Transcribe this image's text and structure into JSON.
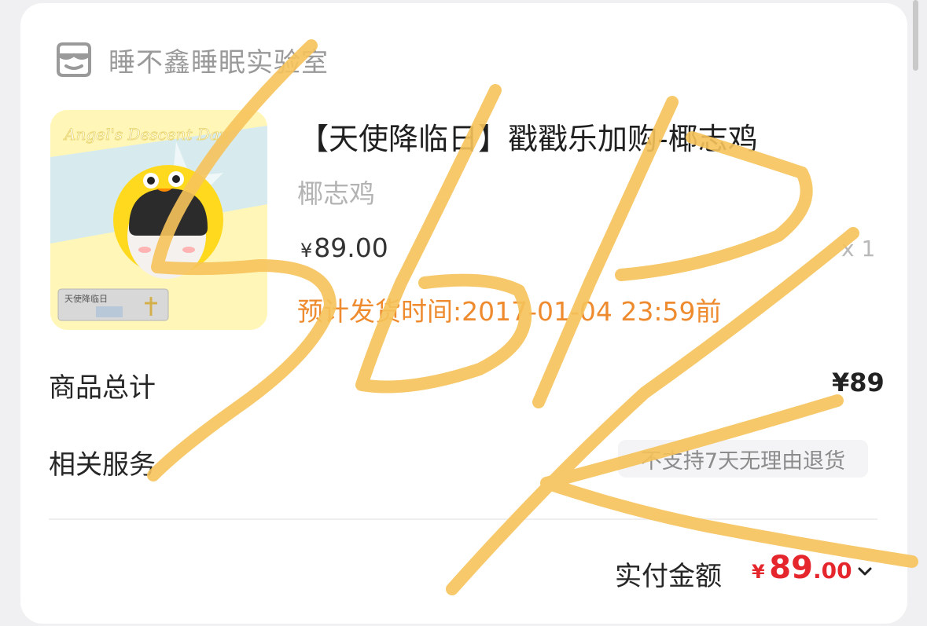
{
  "store": {
    "name": "睡不鑫睡眠实验室",
    "icon": "store-icon"
  },
  "product": {
    "title": "【天使降临日】戳戳乐加购-椰志鸡",
    "variant": "椰志鸡",
    "price_symbol": "¥",
    "price": "89.00",
    "quantity": "x 1",
    "shipping": "预计发货时间:2017-01-04 23:59前",
    "image_text": "Angel's Descent Day",
    "image_tag": "天使降临日"
  },
  "summary": {
    "total_label": "商品总计",
    "total_value": "¥89",
    "service_label": "相关服务",
    "service_value": "不支持7天无理由退货"
  },
  "payment": {
    "label": "实付金额",
    "symbol": "¥",
    "integer": "89",
    "decimal": ".00"
  },
  "colors": {
    "accent_orange": "#ee8b2f",
    "price_red": "#e5262c",
    "scribble": "#f6c35a"
  }
}
